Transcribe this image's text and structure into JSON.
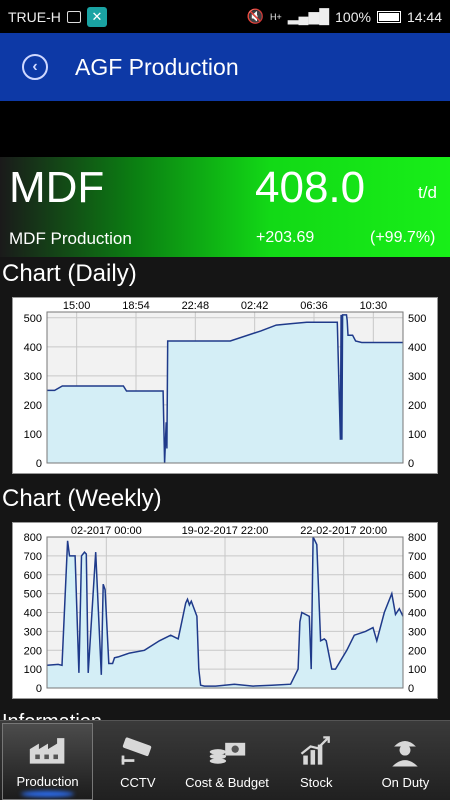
{
  "status_bar": {
    "carrier": "TRUE-H",
    "battery": "100%",
    "time": "14:44",
    "network": "H+"
  },
  "header": {
    "title": "AGF Production",
    "back_icon": "chevron-left-circle-icon"
  },
  "summary": {
    "code": "MDF",
    "value": "408.0",
    "unit": "t/d",
    "name": "MDF Production",
    "delta": "+203.69",
    "delta_pct": "(+99.7%)"
  },
  "sections": {
    "daily_title": "Chart (Daily)",
    "weekly_title": "Chart (Weekly)",
    "more_title": "Information"
  },
  "chart_data": [
    {
      "type": "area",
      "title": "Chart (Daily)",
      "x_tick_labels": [
        "15:00",
        "18:54",
        "22:48",
        "02:42",
        "06:36",
        "10:30"
      ],
      "y_ticks": [
        0,
        100,
        200,
        300,
        400,
        500
      ],
      "ylim": [
        0,
        520
      ],
      "grid": true,
      "fill_color": "#d4eef6",
      "line_color": "#1f3a8a",
      "x": [
        0,
        0.5,
        1.0,
        5.0,
        5.2,
        7.6,
        7.7,
        7.8,
        7.85,
        7.9,
        8.0,
        8.1,
        8.15,
        8.2,
        12.0,
        14.0,
        15.0,
        16.0,
        17.0,
        19.0,
        19.2,
        19.25,
        19.3,
        19.35,
        19.6,
        19.65,
        19.7,
        20.0,
        20.2,
        20.6,
        21.0,
        23.3
      ],
      "values": [
        250,
        250,
        265,
        265,
        248,
        248,
        0,
        140,
        50,
        420,
        420,
        420,
        420,
        420,
        420,
        455,
        475,
        480,
        485,
        485,
        80,
        510,
        80,
        510,
        510,
        490,
        440,
        440,
        420,
        415,
        415,
        415
      ]
    },
    {
      "type": "area",
      "title": "Chart (Weekly)",
      "x_tick_labels": [
        "02-2017 00:00",
        "19-02-2017 22:00",
        "22-02-2017 20:00"
      ],
      "y_ticks": [
        0,
        100,
        200,
        300,
        400,
        500,
        600,
        700,
        800
      ],
      "ylim": [
        0,
        800
      ],
      "grid": true,
      "fill_color": "#d4eef6",
      "line_color": "#1f3a8a",
      "x": [
        0,
        0.3,
        0.4,
        0.55,
        0.6,
        0.75,
        0.85,
        0.92,
        1.0,
        1.05,
        1.1,
        1.3,
        1.45,
        1.5,
        1.55,
        1.65,
        1.75,
        1.8,
        1.9,
        2.2,
        2.6,
        3.0,
        3.3,
        3.5,
        3.7,
        3.75,
        3.8,
        3.85,
        4.0,
        4.05,
        4.1,
        4.2,
        4.3,
        4.5,
        5.0,
        5.5,
        6.0,
        6.5,
        6.7,
        6.75,
        6.8,
        7.0,
        7.05,
        7.1,
        7.2,
        7.3,
        7.4,
        7.45,
        7.6,
        7.7,
        8.0,
        8.2,
        8.5,
        8.7,
        8.8,
        9.0,
        9.1,
        9.2,
        9.3,
        9.4,
        9.5
      ],
      "values": [
        120,
        125,
        120,
        780,
        700,
        700,
        80,
        700,
        720,
        710,
        80,
        720,
        70,
        550,
        520,
        130,
        130,
        160,
        165,
        185,
        200,
        250,
        280,
        260,
        450,
        470,
        440,
        460,
        380,
        100,
        15,
        10,
        10,
        10,
        20,
        10,
        15,
        20,
        100,
        350,
        400,
        380,
        100,
        800,
        760,
        250,
        260,
        250,
        100,
        100,
        200,
        280,
        300,
        320,
        250,
        400,
        450,
        500,
        390,
        420,
        380
      ]
    }
  ],
  "tabs": [
    {
      "label": "Production",
      "icon": "factory-icon",
      "active": true
    },
    {
      "label": "CCTV",
      "icon": "cctv-camera-icon",
      "active": false
    },
    {
      "label": "Cost & Budget",
      "icon": "coins-money-icon",
      "active": false
    },
    {
      "label": "Stock",
      "icon": "stock-chart-icon",
      "active": false
    },
    {
      "label": "On Duty",
      "icon": "worker-icon",
      "active": false
    }
  ],
  "colors": {
    "appbar": "#0d39a6",
    "banner_green": "#18ef18",
    "tab_highlight": "#2c6df0"
  }
}
